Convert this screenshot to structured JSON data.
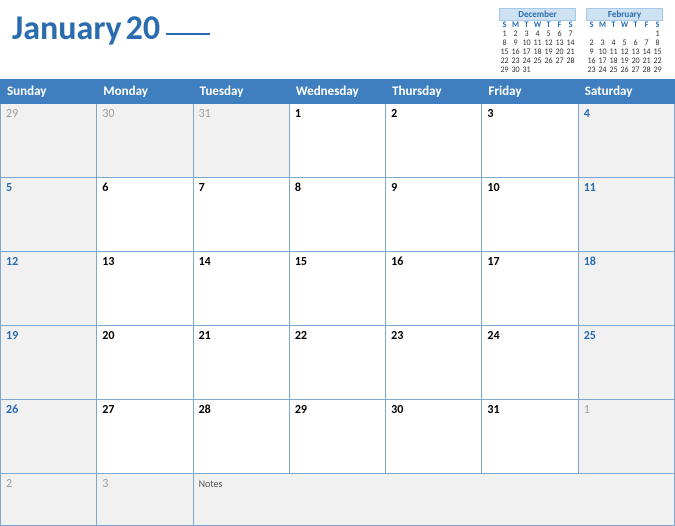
{
  "title": {
    "month": "January",
    "year_prefix": "20"
  },
  "mini_calendars": [
    {
      "title": "December",
      "dow": [
        "S",
        "M",
        "T",
        "W",
        "T",
        "F",
        "S"
      ],
      "weeks": [
        [
          "1",
          "2",
          "3",
          "4",
          "5",
          "6",
          "7"
        ],
        [
          "8",
          "9",
          "10",
          "11",
          "12",
          "13",
          "14"
        ],
        [
          "15",
          "16",
          "17",
          "18",
          "19",
          "20",
          "21"
        ],
        [
          "22",
          "23",
          "24",
          "25",
          "26",
          "27",
          "28"
        ],
        [
          "29",
          "30",
          "31",
          "",
          "",
          "",
          ""
        ]
      ]
    },
    {
      "title": "February",
      "dow": [
        "S",
        "M",
        "T",
        "W",
        "T",
        "F",
        "S"
      ],
      "weeks": [
        [
          "",
          "",
          "",
          "",
          "",
          "",
          "1"
        ],
        [
          "2",
          "3",
          "4",
          "5",
          "6",
          "7",
          "8"
        ],
        [
          "9",
          "10",
          "11",
          "12",
          "13",
          "14",
          "15"
        ],
        [
          "16",
          "17",
          "18",
          "19",
          "20",
          "21",
          "22"
        ],
        [
          "23",
          "24",
          "25",
          "26",
          "27",
          "28",
          "29"
        ]
      ]
    }
  ],
  "day_headers": [
    "Sunday",
    "Monday",
    "Tuesday",
    "Wednesday",
    "Thursday",
    "Friday",
    "Saturday"
  ],
  "weeks": [
    [
      {
        "d": "29",
        "other": true
      },
      {
        "d": "30",
        "other": true
      },
      {
        "d": "31",
        "other": true
      },
      {
        "d": "1"
      },
      {
        "d": "2"
      },
      {
        "d": "3"
      },
      {
        "d": "4",
        "weekend": true
      }
    ],
    [
      {
        "d": "5",
        "weekend": true
      },
      {
        "d": "6"
      },
      {
        "d": "7"
      },
      {
        "d": "8"
      },
      {
        "d": "9"
      },
      {
        "d": "10"
      },
      {
        "d": "11",
        "weekend": true
      }
    ],
    [
      {
        "d": "12",
        "weekend": true
      },
      {
        "d": "13"
      },
      {
        "d": "14"
      },
      {
        "d": "15"
      },
      {
        "d": "16"
      },
      {
        "d": "17"
      },
      {
        "d": "18",
        "weekend": true
      }
    ],
    [
      {
        "d": "19",
        "weekend": true
      },
      {
        "d": "20"
      },
      {
        "d": "21"
      },
      {
        "d": "22"
      },
      {
        "d": "23"
      },
      {
        "d": "24"
      },
      {
        "d": "25",
        "weekend": true
      }
    ],
    [
      {
        "d": "26",
        "weekend": true
      },
      {
        "d": "27"
      },
      {
        "d": "28"
      },
      {
        "d": "29"
      },
      {
        "d": "30"
      },
      {
        "d": "31"
      },
      {
        "d": "1",
        "other": true
      }
    ]
  ],
  "last_row": {
    "cells": [
      {
        "d": "2",
        "other": true
      },
      {
        "d": "3",
        "other": true
      }
    ],
    "notes_label": "Notes"
  }
}
